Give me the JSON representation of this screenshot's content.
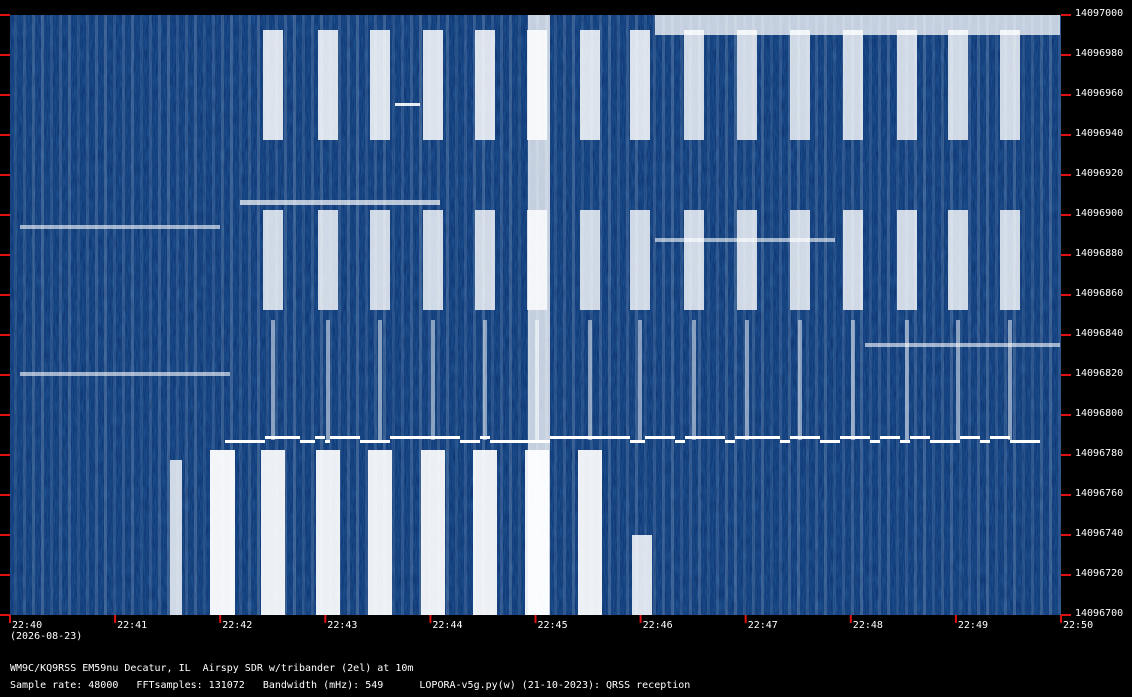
{
  "chart_data": {
    "type": "heatmap",
    "title": "",
    "xlabel": "",
    "ylabel": "",
    "x_ticks": [
      "22:40",
      "22:41",
      "22:42",
      "22:43",
      "22:44",
      "22:45",
      "22:46",
      "22:47",
      "22:48",
      "22:49",
      "22:50"
    ],
    "y_ticks": [
      14097000,
      14096980,
      14096960,
      14096940,
      14096920,
      14096900,
      14096880,
      14096860,
      14096840,
      14096820,
      14096800,
      14096780,
      14096760,
      14096740,
      14096720,
      14096700
    ],
    "ylim": [
      14096700,
      14097000
    ],
    "date_label": "(2026-08-23)",
    "colormap": {
      "background": "#0a2f6b",
      "signal": "#ffffff",
      "tick": "#e01010"
    }
  },
  "footer": {
    "station": "WM9C/KQ9RSS EM59nu Decatur, IL  Airspy SDR w/tribander (2el) at 10m",
    "params": "Sample rate: 48000   FFTsamples: 131072   Bandwidth (mHz): 549      LOPORA-v5g.py(w) (21-10-2023): QRSS reception"
  }
}
